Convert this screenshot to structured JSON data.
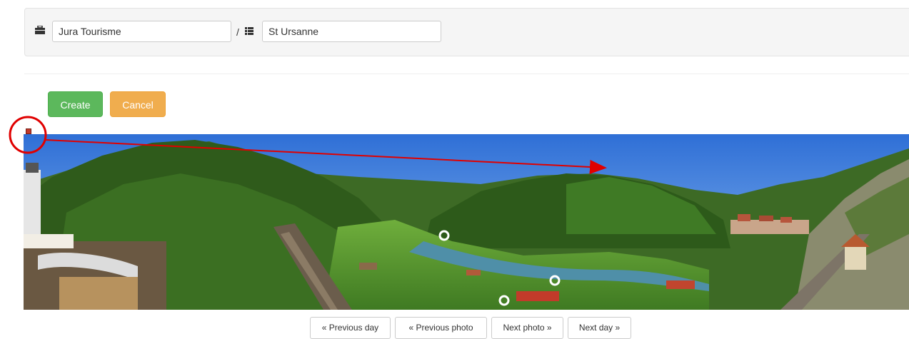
{
  "filter_bar": {
    "company_value": "Jura Tourisme",
    "separator": "/",
    "location_value": "St Ursanne"
  },
  "icons": {
    "company": "briefcase-icon",
    "location": "list-icon"
  },
  "actions": {
    "create_label": "Create",
    "cancel_label": "Cancel"
  },
  "pager": {
    "previous_day": "« Previous day",
    "previous_photo": "« Previous photo",
    "next_photo": "Next photo »",
    "next_day": "Next day »"
  },
  "colors": {
    "create": "#5cb85c",
    "cancel": "#f0ad4e",
    "annotation": "#e00000"
  }
}
